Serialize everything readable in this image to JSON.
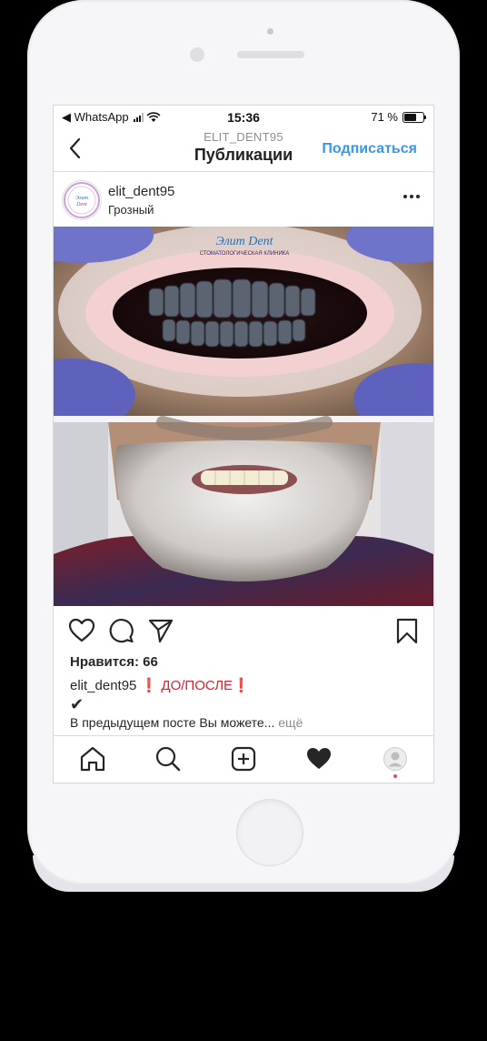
{
  "status_bar": {
    "back_app": "◀ WhatsApp",
    "time": "15:36",
    "battery": "71 %",
    "battery_level": 0.71
  },
  "nav": {
    "subtitle": "ELIT_DENT95",
    "title": "Публикации",
    "follow_label": "Подписаться"
  },
  "post": {
    "username": "elit_dent95",
    "location": "Грозный",
    "logo_text": "Элит Dent",
    "logo_subtext": "СТОМАТОЛОГИЧЕСКАЯ КЛИНИКА",
    "likes": "Нравится: 66",
    "caption_user": "elit_dent95",
    "caption_text": " ❗ ДО/ПОСЛЕ❗",
    "caption_check": "✔",
    "preview_text": "В предыдущем посте Вы можете...",
    "preview_more": " ещё"
  },
  "colors": {
    "accent": "#3897f0",
    "text": "#262626",
    "muted": "#8e8e8e",
    "notification": "#ed4956"
  },
  "icons": {
    "back": "chevron-left-icon",
    "more": "ellipsis-icon",
    "like": "heart-outline-icon",
    "comment": "comment-icon",
    "share": "paper-plane-icon",
    "save": "bookmark-icon",
    "home": "home-icon",
    "search": "search-icon",
    "new_post": "plus-square-icon",
    "activity": "heart-filled-icon",
    "profile": "profile-icon"
  }
}
